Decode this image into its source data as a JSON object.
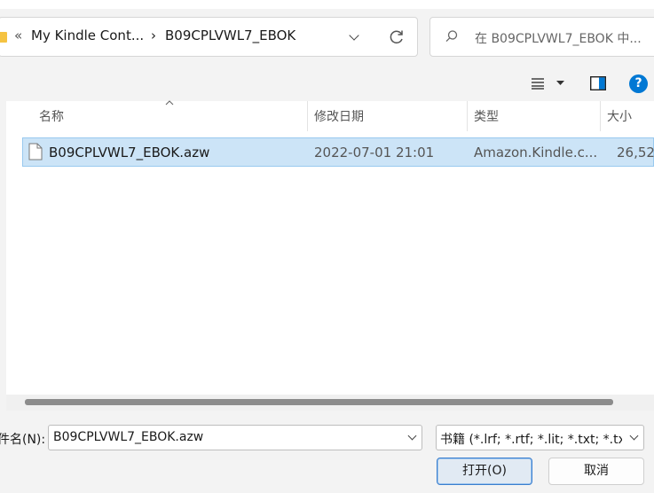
{
  "address_bar": {
    "overflow_glyph": "«",
    "crumbs": [
      "My Kindle Cont...",
      "B09CPLVWL7_EBOK"
    ],
    "separator": "›"
  },
  "search": {
    "placeholder": "在 B09CPLVWL7_EBOK 中..."
  },
  "columns": {
    "name": "名称",
    "date": "修改日期",
    "type": "类型",
    "size": "大小"
  },
  "files": [
    {
      "name": "B09CPLVWL7_EBOK.azw",
      "date": "2022-07-01 21:01",
      "type": "Amazon.Kindle.c...",
      "size": "26,52"
    }
  ],
  "bottom": {
    "filename_label": "件名(N):",
    "filename_value": "B09CPLVWL7_EBOK.azw",
    "filetype_value": "书籍 (*.lrf; *.rtf; *.lit; *.txt; *.tx",
    "open_label": "打开(O)",
    "cancel_label": "取消"
  },
  "help_glyph": "?",
  "colors": {
    "accent": "#0078d4",
    "selection": "#cce4f7",
    "folder": "#f5c342"
  }
}
